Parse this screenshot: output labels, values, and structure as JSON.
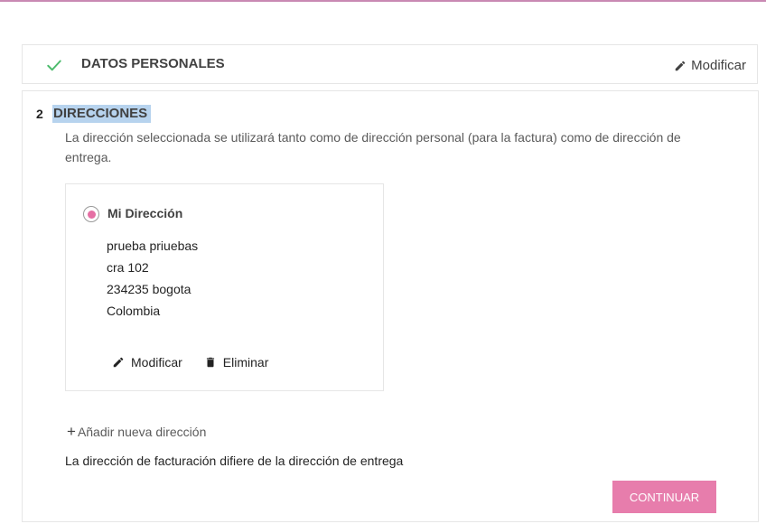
{
  "colors": {
    "accent": "#e56fa4",
    "check": "#4cbb6c",
    "selection_highlight": "#b7d3ee",
    "top_rule": "#c989b3"
  },
  "personal_step": {
    "icon": "check-icon",
    "title": "DATOS PERSONALES",
    "edit_icon": "pencil-icon",
    "edit_label": "Modificar"
  },
  "addresses_step": {
    "number": "2",
    "title": "DIRECCIONES",
    "description": "La dirección seleccionada se utilizará tanto como de dirección personal (para la factura) como de dirección de entrega.",
    "address": {
      "selected": true,
      "alias": "Mi Dirección",
      "lines": [
        "prueba priuebas",
        "cra 102",
        "234235 bogota",
        "Colombia"
      ],
      "edit_label": "Modificar",
      "edit_icon": "pencil-icon",
      "delete_label": "Eliminar",
      "delete_icon": "trash-icon"
    },
    "add_address_icon": "plus-icon",
    "add_address_label": "Añadir nueva dirección",
    "billing_differs_label": "La dirección de facturación difiere de la dirección de entrega",
    "continue_label": "CONTINUAR"
  }
}
